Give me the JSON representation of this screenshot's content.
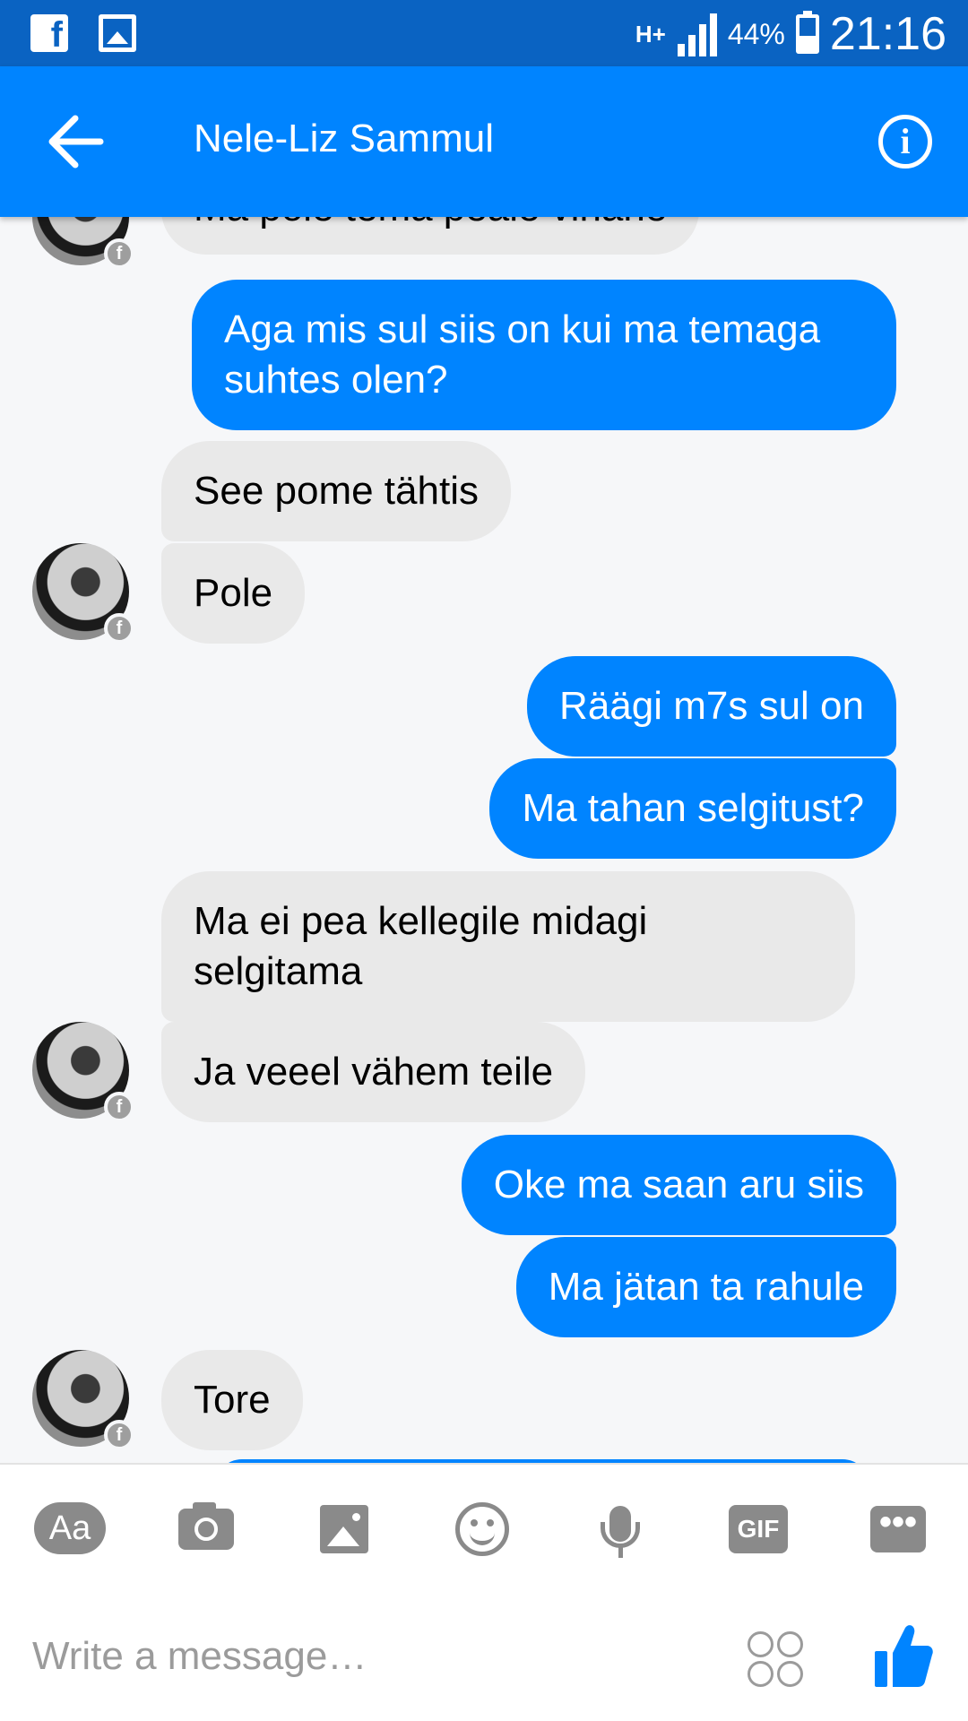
{
  "status_bar": {
    "network": "H+",
    "battery": "44%",
    "battery_level": 0.44,
    "time": "21:16"
  },
  "header": {
    "contact_name": "Nele-Liz Sammul"
  },
  "messages": [
    {
      "from": "them",
      "text": "Ma pole tema peale vihane"
    },
    {
      "from": "me",
      "text": "Aga mis sul siis on kui ma temaga suhtes olen?"
    },
    {
      "from": "them",
      "text": "See pome tähtis"
    },
    {
      "from": "them",
      "text": "Pole"
    },
    {
      "from": "me",
      "text": "Räägi m7s sul on"
    },
    {
      "from": "me",
      "text": "Ma tahan selgitust?"
    },
    {
      "from": "them",
      "text": "Ma ei pea kellegile midagi selgitama"
    },
    {
      "from": "them",
      "text": "Ja veeel vähem teile"
    },
    {
      "from": "me",
      "text": "Oke ma saan aru siis"
    },
    {
      "from": "me",
      "text": "Ma jätan ta rahule"
    },
    {
      "from": "them",
      "text": "Tore"
    }
  ],
  "toolbar": {
    "text_button_label": "Aa",
    "gif_label": "GIF",
    "more_label": "•••"
  },
  "composer": {
    "placeholder": "Write a message…",
    "value": ""
  },
  "colors": {
    "accent": "#0084ff",
    "status_bar": "#0a63c2",
    "incoming_bubble": "#e9e9e9",
    "icon_gray": "#8a8a8a"
  },
  "icons": [
    "facebook-icon",
    "image-notification-icon",
    "signal-icon",
    "battery-icon",
    "back-arrow-icon",
    "info-icon",
    "camera-icon",
    "gallery-icon",
    "emoji-icon",
    "microphone-icon",
    "gif-icon",
    "more-icon",
    "stickers-icon",
    "thumbs-up-icon"
  ]
}
